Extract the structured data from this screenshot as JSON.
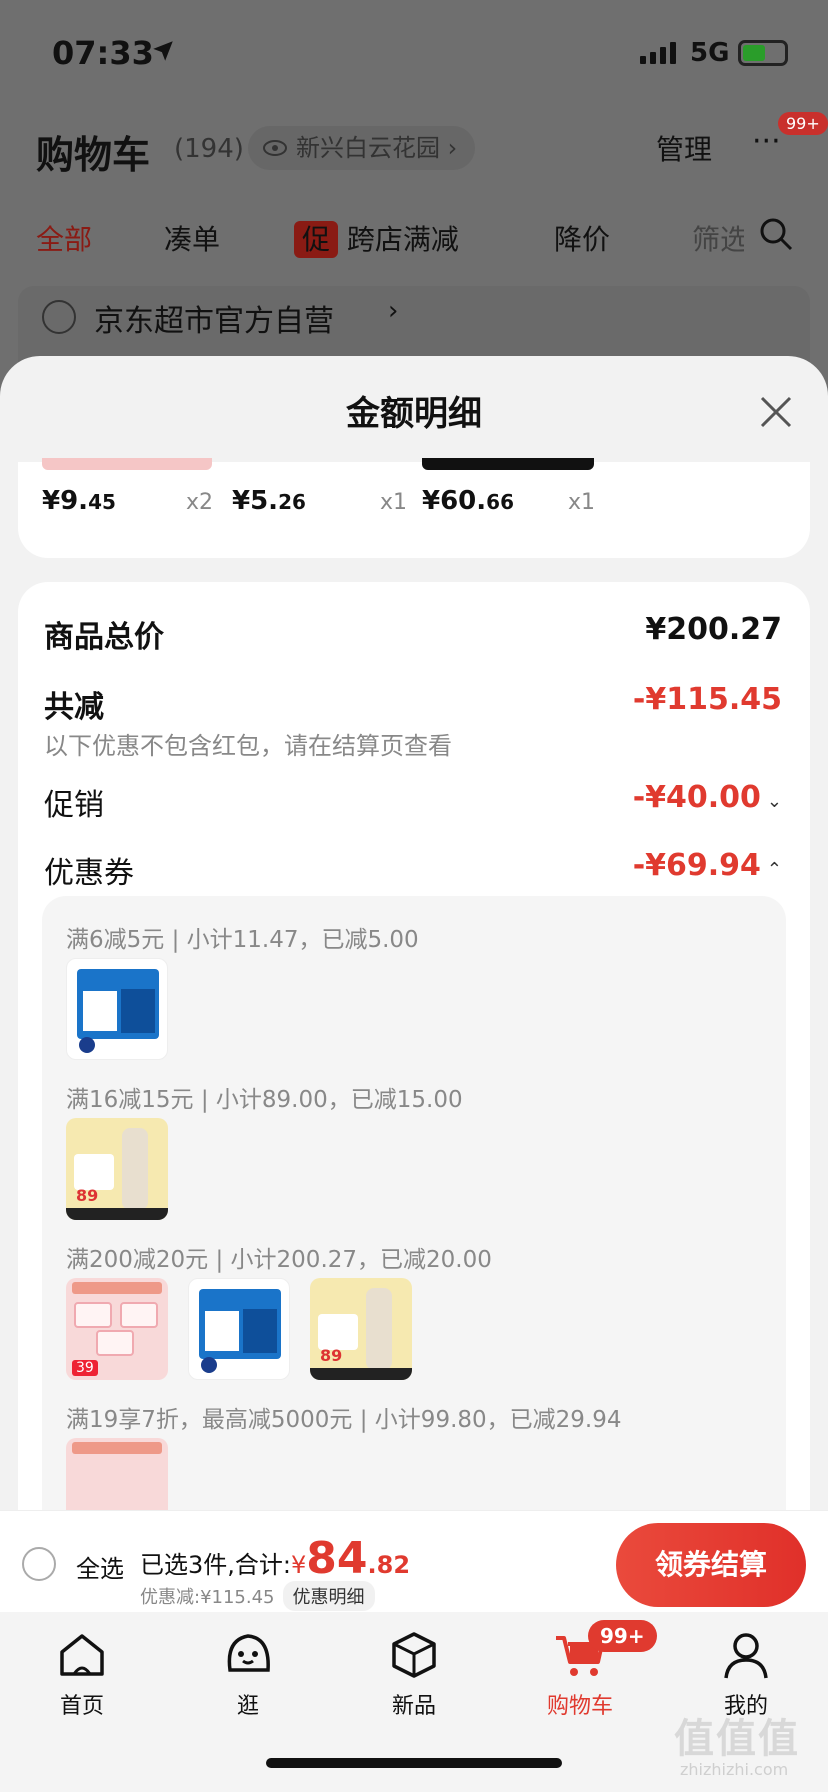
{
  "status_bar": {
    "time": "07:33",
    "network": "5G"
  },
  "cart_header": {
    "title": "购物车",
    "count": "(194)",
    "location": "新兴白云花园",
    "manage": "管理",
    "more_badge": "99+"
  },
  "cart_tabs": {
    "all": "全部",
    "bundle": "凑单",
    "promo_tag": "促",
    "cross_shop": "跨店满减",
    "price_drop": "降价",
    "filter": "筛选"
  },
  "shop": {
    "name": "京东超市官方自营"
  },
  "modal": {
    "title": "金额明细",
    "items": [
      {
        "price_main": "¥9.",
        "price_cents": "45",
        "qty": "x2"
      },
      {
        "price_main": "¥5.",
        "price_cents": "26",
        "qty": "x1"
      },
      {
        "price_main": "¥60.",
        "price_cents": "66",
        "qty": "x1"
      }
    ],
    "goods_total_label": "商品总价",
    "goods_total_value": "¥200.27",
    "total_reduce_label": "共减",
    "total_reduce_value": "-¥115.45",
    "note": "以下优惠不包含红包，请在结算页查看",
    "promo_label": "促销",
    "promo_value": "-¥40.00",
    "coupon_label": "优惠券",
    "coupon_value": "-¥69.94",
    "coupon_rules": [
      "满6减5元 | 小计11.47，已减5.00",
      "满16减15元 | 小计89.00，已减15.00",
      "满200减20元 | 小计200.27，已减20.00",
      "满19享7折，最高减5000元 | 小计99.80，已减29.94"
    ],
    "thumb_prices": {
      "cup": "89",
      "tissue": "39"
    }
  },
  "checkout": {
    "select_all": "全选",
    "summary_prefix": "已选3件,合计:",
    "yen": "¥",
    "total_int": "84",
    "total_cents": ".82",
    "discount": "优惠减:¥115.45",
    "detail_link": "优惠明细",
    "button": "领券结算"
  },
  "tabbar": {
    "home": "首页",
    "browse": "逛",
    "new": "新品",
    "cart": "购物车",
    "me": "我的",
    "cart_badge": "99+"
  },
  "watermark": {
    "main": "值值值",
    "sub": "zhizhizhi.com"
  }
}
